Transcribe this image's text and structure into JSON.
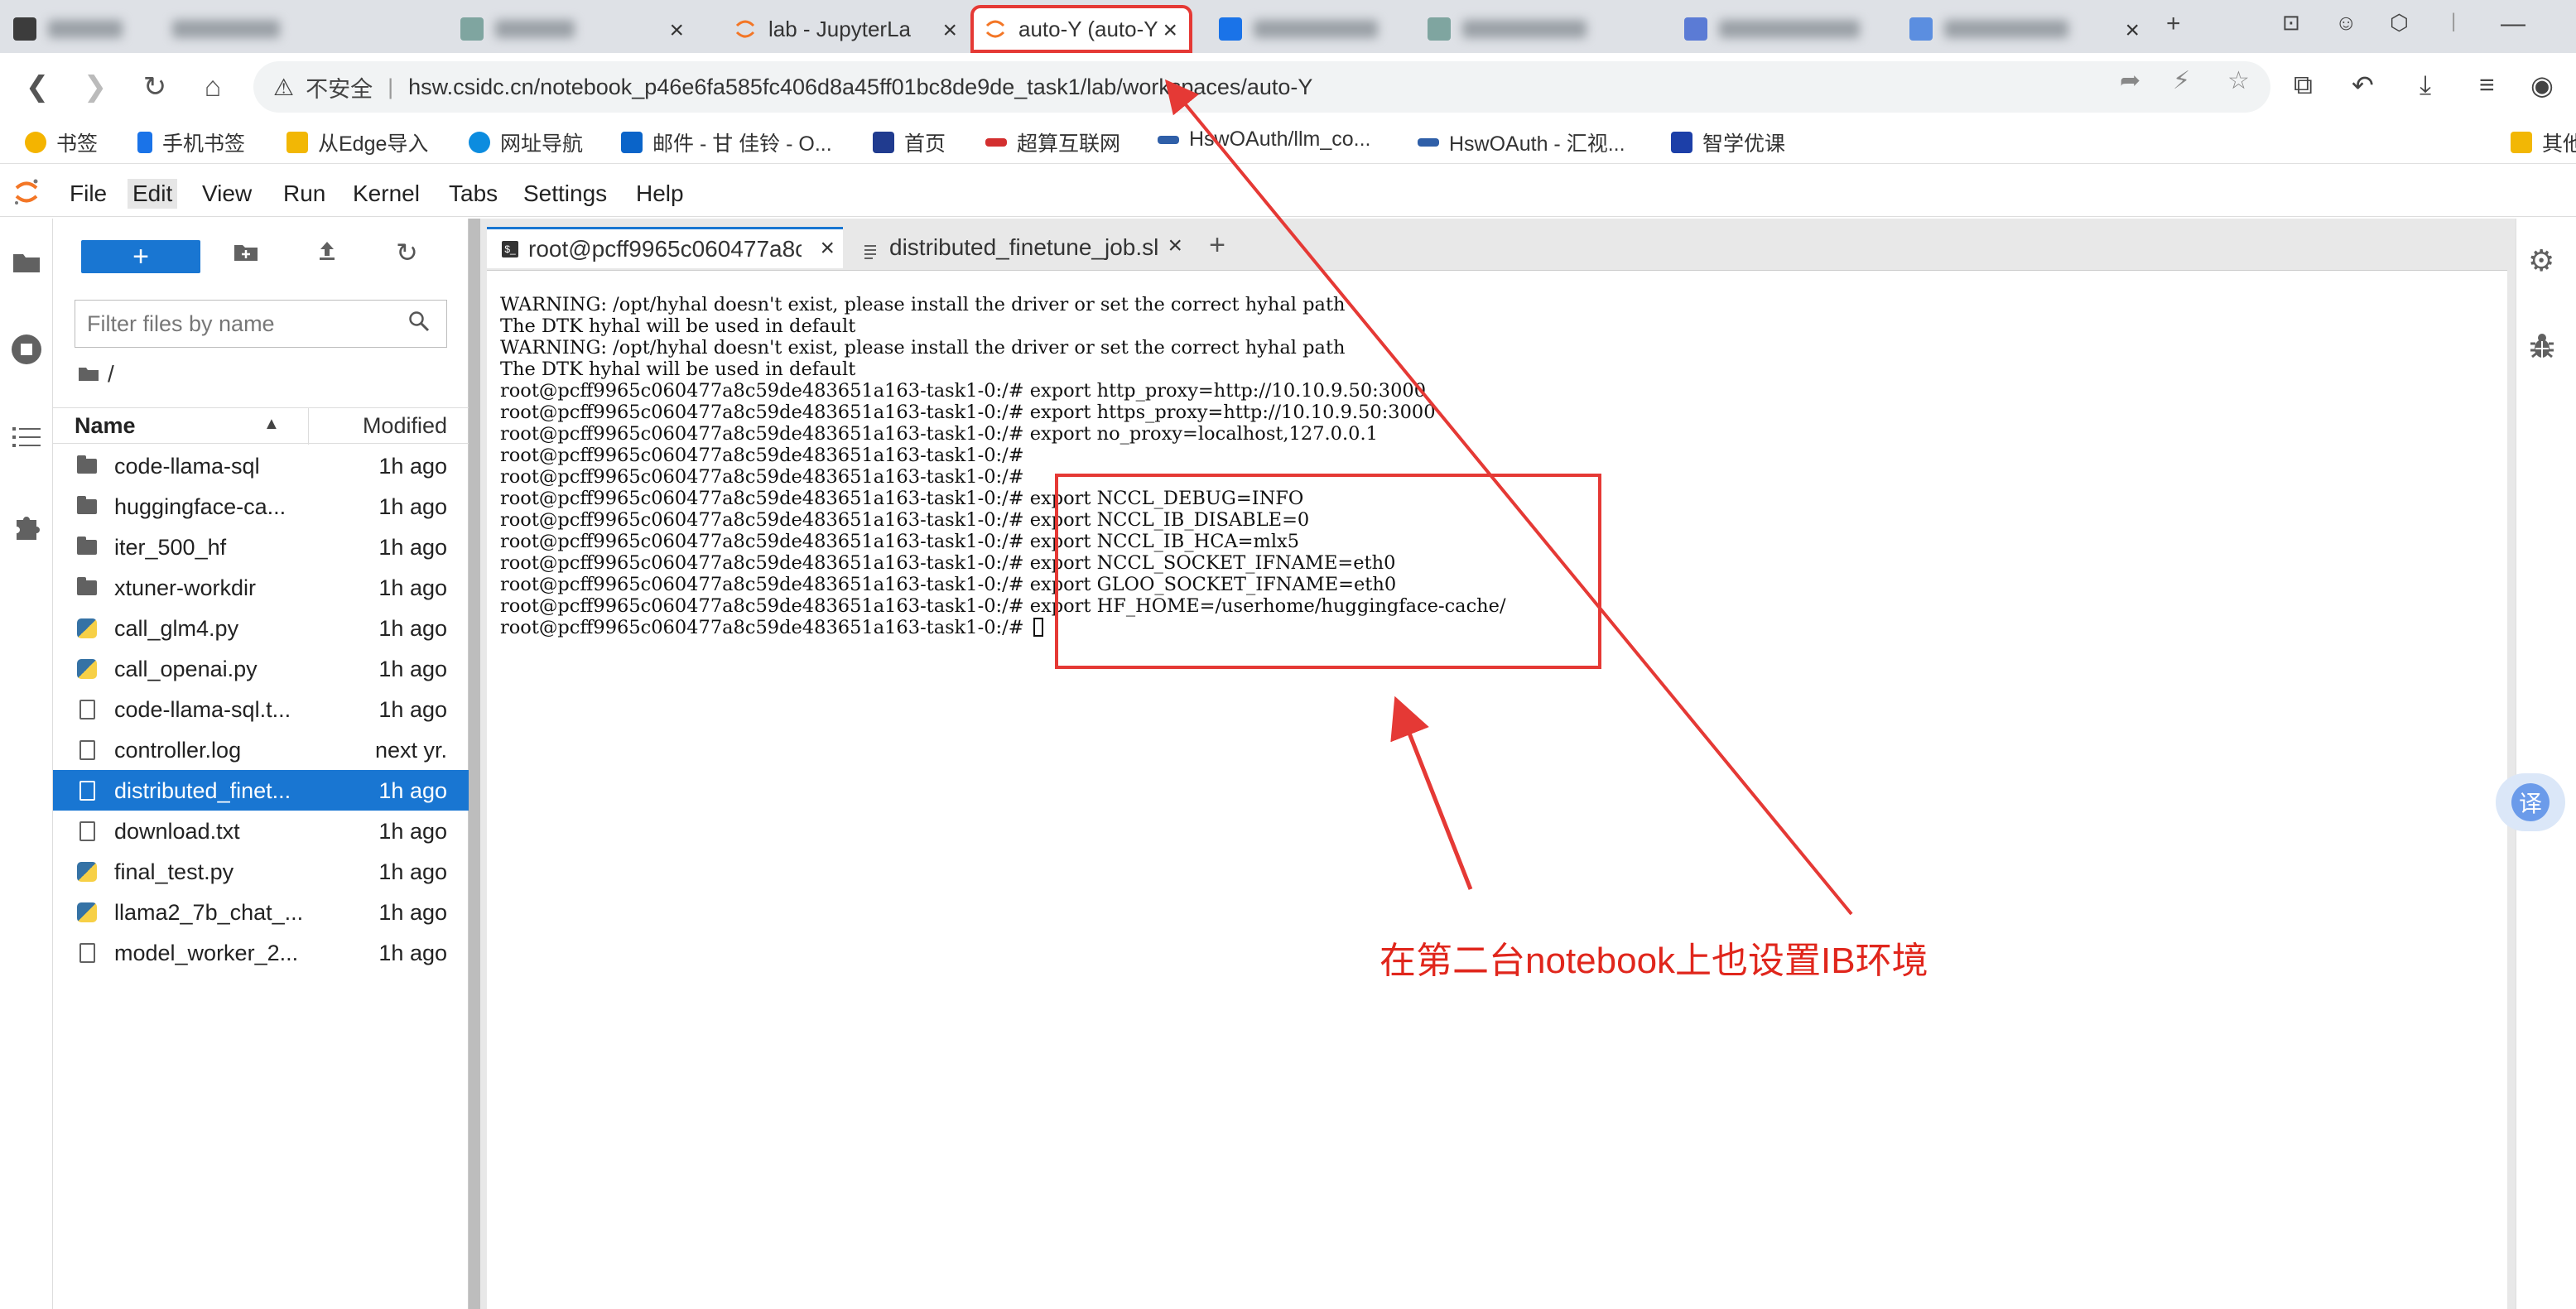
{
  "browser": {
    "tabs": [
      {
        "title": "",
        "blurred": true
      },
      {
        "title": "",
        "blurred": true
      },
      {
        "title": "lab - JupyterLa",
        "blurred": false
      },
      {
        "title": "auto-Y (auto-Y",
        "blurred": false,
        "active": true
      },
      {
        "title": "",
        "blurred": true
      },
      {
        "title": "",
        "blurred": true
      },
      {
        "title": "",
        "blurred": true
      }
    ],
    "tab_close": "×",
    "new_tab": "+",
    "window_controls": {
      "minimize": "—",
      "maximize": "▢",
      "close": "✕"
    }
  },
  "address_bar": {
    "warning_label": "不安全",
    "url": "hsw.csidc.cn/notebook_p46e6fa585fc406d8a45ff01bc8de9de_task1/lab/workspaces/auto-Y"
  },
  "bookmarks": [
    {
      "label": "书签",
      "icon": "star-icon",
      "color": "#f4b400"
    },
    {
      "label": "手机书签",
      "icon": "phone-icon",
      "color": "#1a73e8"
    },
    {
      "label": "从Edge导入",
      "icon": "folder-icon",
      "color": "#f2b705"
    },
    {
      "label": "网址导航",
      "icon": "edge-icon",
      "color": "#0c8cdf"
    },
    {
      "label": "邮件 - 甘 佳铃 - O...",
      "icon": "outlook-icon",
      "color": "#0a64c9"
    },
    {
      "label": "首页",
      "icon": "logo-icon",
      "color": "#203b8f"
    },
    {
      "label": "超算互联网",
      "icon": "scnet-icon",
      "color": "#d32f2f"
    },
    {
      "label": "HswOAuth/llm_co...",
      "icon": "hsw-icon",
      "color": "#2f5fa8"
    },
    {
      "label": "HswOAuth - 汇视...",
      "icon": "hsw-icon",
      "color": "#2f5fa8"
    },
    {
      "label": "智学优课",
      "icon": "edu-icon",
      "color": "#1c3fa8"
    },
    {
      "label": "其他",
      "icon": "folder-icon",
      "color": "#f2b705"
    }
  ],
  "jupyter": {
    "menu": [
      "File",
      "Edit",
      "View",
      "Run",
      "Kernel",
      "Tabs",
      "Settings",
      "Help"
    ],
    "active_menu": "Edit",
    "accent": "#1976d2"
  },
  "filebrowser": {
    "new_label": "+",
    "filter_placeholder": "Filter files by name",
    "breadcrumb": "/",
    "col_name": "Name",
    "col_modified": "Modified",
    "files": [
      {
        "name": "code-llama-sql",
        "type": "folder",
        "modified": "1h ago"
      },
      {
        "name": "huggingface-ca...",
        "type": "folder",
        "modified": "1h ago"
      },
      {
        "name": "iter_500_hf",
        "type": "folder",
        "modified": "1h ago"
      },
      {
        "name": "xtuner-workdir",
        "type": "folder",
        "modified": "1h ago"
      },
      {
        "name": "call_glm4.py",
        "type": "python",
        "modified": "1h ago"
      },
      {
        "name": "call_openai.py",
        "type": "python",
        "modified": "1h ago"
      },
      {
        "name": "code-llama-sql.t...",
        "type": "file",
        "modified": "1h ago"
      },
      {
        "name": "controller.log",
        "type": "file",
        "modified": "next yr."
      },
      {
        "name": "distributed_finet...",
        "type": "file",
        "modified": "1h ago",
        "selected": true
      },
      {
        "name": "download.txt",
        "type": "file",
        "modified": "1h ago"
      },
      {
        "name": "final_test.py",
        "type": "python",
        "modified": "1h ago"
      },
      {
        "name": "llama2_7b_chat_...",
        "type": "python",
        "modified": "1h ago"
      },
      {
        "name": "model_worker_2...",
        "type": "file",
        "modified": "1h ago"
      }
    ]
  },
  "editor_tabs": [
    {
      "title": "root@pcff9965c060477a8c",
      "kind": "terminal",
      "active": true
    },
    {
      "title": "distributed_finetune_job.sl",
      "kind": "file",
      "active": false
    }
  ],
  "terminal_lines": [
    "WARNING: /opt/hyhal doesn't exist, please install the driver or set the correct hyhal path",
    "The DTK hyhal will be used in default",
    "WARNING: /opt/hyhal doesn't exist, please install the driver or set the correct hyhal path",
    "The DTK hyhal will be used in default",
    "root@pcff9965c060477a8c59de483651a163-task1-0:/# export http_proxy=http://10.10.9.50:3000",
    "root@pcff9965c060477a8c59de483651a163-task1-0:/# export https_proxy=http://10.10.9.50:3000",
    "root@pcff9965c060477a8c59de483651a163-task1-0:/# export no_proxy=localhost,127.0.0.1",
    "root@pcff9965c060477a8c59de483651a163-task1-0:/#",
    "root@pcff9965c060477a8c59de483651a163-task1-0:/#",
    "root@pcff9965c060477a8c59de483651a163-task1-0:/# export NCCL_DEBUG=INFO",
    "root@pcff9965c060477a8c59de483651a163-task1-0:/# export NCCL_IB_DISABLE=0",
    "root@pcff9965c060477a8c59de483651a163-task1-0:/# export NCCL_IB_HCA=mlx5",
    "root@pcff9965c060477a8c59de483651a163-task1-0:/# export NCCL_SOCKET_IFNAME=eth0",
    "root@pcff9965c060477a8c59de483651a163-task1-0:/# export GLOO_SOCKET_IFNAME=eth0",
    "root@pcff9965c060477a8c59de483651a163-task1-0:/# export HF_HOME=/userhome/huggingface-cache/",
    "root@pcff9965c060477a8c59de483651a163-task1-0:/# "
  ],
  "annotation": {
    "text": "在第二台notebook上也设置IB环境",
    "color": "#e0261c"
  },
  "translate_button": "译"
}
